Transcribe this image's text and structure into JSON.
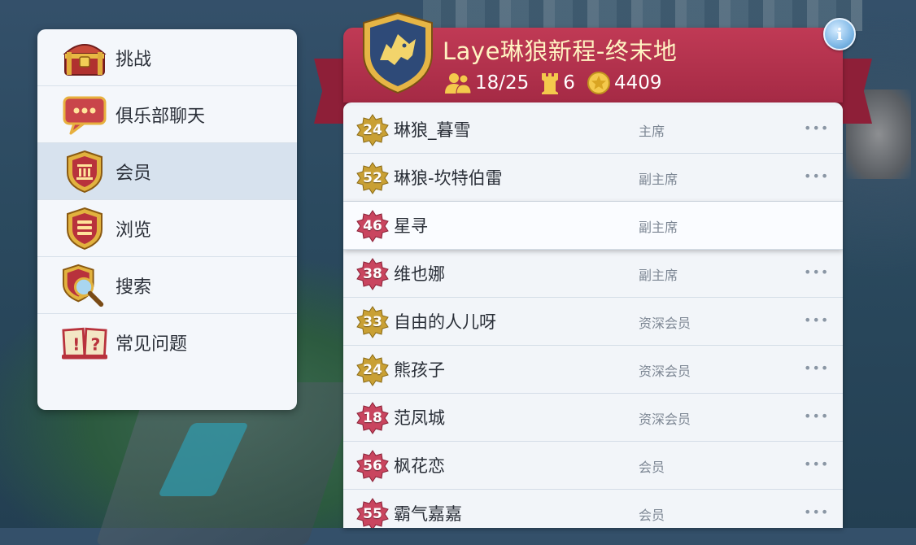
{
  "menu": {
    "items": [
      {
        "label": "挑战",
        "icon": "treasure-chest-icon"
      },
      {
        "label": "俱乐部聊天",
        "icon": "chat-bubble-icon"
      },
      {
        "label": "会员",
        "icon": "members-shield-icon",
        "active": true
      },
      {
        "label": "浏览",
        "icon": "browse-shield-icon"
      },
      {
        "label": "搜索",
        "icon": "search-magnifier-icon"
      },
      {
        "label": "常见问题",
        "icon": "faq-book-icon"
      }
    ]
  },
  "club": {
    "name": "Laye琳狼新程-终末地",
    "members_count": "18/25",
    "towers": "6",
    "points": "4409",
    "emblem_icon": "wolf-shield-icon",
    "info_icon": "info-icon",
    "info_label": "i"
  },
  "members": [
    {
      "level": "24",
      "badge": "gold",
      "name": "琳狼_暮雪",
      "role": "主席"
    },
    {
      "level": "52",
      "badge": "gold",
      "name": "琳狼-坎特伯雷",
      "role": "副主席"
    },
    {
      "level": "46",
      "badge": "red",
      "name": "星寻",
      "role": "副主席",
      "selected": true
    },
    {
      "level": "38",
      "badge": "red",
      "name": "维也娜",
      "role": "副主席"
    },
    {
      "level": "33",
      "badge": "gold",
      "name": "自由的人儿呀",
      "role": "资深会员"
    },
    {
      "level": "24",
      "badge": "gold",
      "name": "熊孩子",
      "role": "资深会员"
    },
    {
      "level": "18",
      "badge": "red",
      "name": "范凤城",
      "role": "资深会员"
    },
    {
      "level": "56",
      "badge": "red",
      "name": "枫花恋",
      "role": "会员"
    },
    {
      "level": "55",
      "badge": "red",
      "name": "霸气嘉嘉",
      "role": "会员"
    }
  ],
  "more_label": "•••",
  "colors": {
    "header": "#b3314d",
    "badge_gold": "#c9a034",
    "badge_red": "#c9455f"
  }
}
